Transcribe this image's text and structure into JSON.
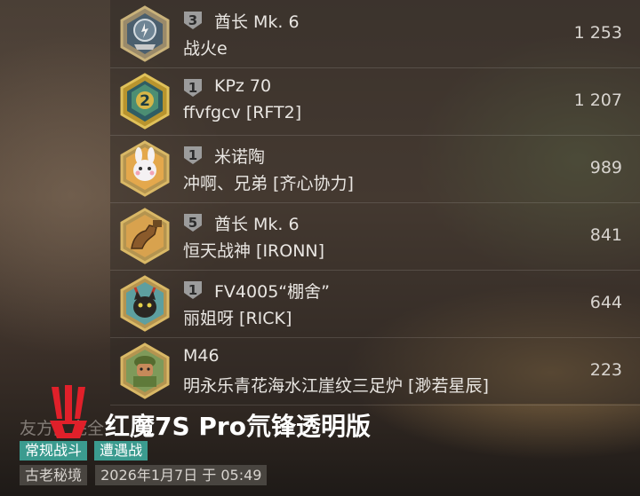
{
  "rows": [
    {
      "tier": "3",
      "tank": "酋长 Mk. 6",
      "player": "战火e",
      "score": "1 253"
    },
    {
      "tier": "1",
      "tank": "KPz 70",
      "player": "ffvfgcv [RFT2]",
      "score": "1 207"
    },
    {
      "tier": "1",
      "tank": "米诺陶",
      "player": "冲啊、兄弟 [齐心协力]",
      "score": "989"
    },
    {
      "tier": "5",
      "tank": "酋长 Mk. 6",
      "player": "恒天战神 [IRONN]",
      "score": "841"
    },
    {
      "tier": "1",
      "tank": "FV4005“棚舍”",
      "player": "丽姐呀 [RICK]",
      "score": "644"
    },
    {
      "tier": "",
      "tank": "M46",
      "player": "明永乐青花海水江崖纹三足炉 [渺若星辰]",
      "score": "223"
    }
  ],
  "avatars": [
    "medal-icon",
    "rank-2-icon",
    "bunny-icon",
    "arm-icon",
    "cat-icon",
    "soldier-icon"
  ],
  "footer": {
    "ghost_text": "友方团完全",
    "title": "红魔7S Pro氘锋透明版",
    "tags": [
      "常规战斗",
      "遭遇战"
    ],
    "map": "古老秘境",
    "date": "2026年1月7日 于 05:49"
  },
  "colors": {
    "tag": "#3b9b8f",
    "logo": "#e0202a",
    "hex_border": "#b49450"
  }
}
